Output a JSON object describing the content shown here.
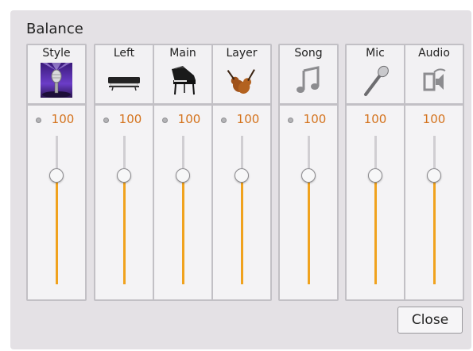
{
  "panel": {
    "title": "Balance"
  },
  "channels": [
    {
      "id": "style",
      "label": "Style",
      "value": "100",
      "level": 0.73,
      "led": true,
      "icon": "microphone-stage-image"
    },
    {
      "id": "left",
      "label": "Left",
      "value": "100",
      "level": 0.73,
      "led": true,
      "icon": "keyboard-icon"
    },
    {
      "id": "main",
      "label": "Main",
      "value": "100",
      "level": 0.73,
      "led": true,
      "icon": "grand-piano-icon"
    },
    {
      "id": "layer",
      "label": "Layer",
      "value": "100",
      "level": 0.73,
      "led": true,
      "icon": "violins-icon"
    },
    {
      "id": "song",
      "label": "Song",
      "value": "100",
      "level": 0.73,
      "led": true,
      "icon": "music-note-icon"
    },
    {
      "id": "mic",
      "label": "Mic",
      "value": "100",
      "level": 0.73,
      "led": false,
      "icon": "microphone-icon"
    },
    {
      "id": "audio",
      "label": "Audio",
      "value": "100",
      "level": 0.73,
      "led": false,
      "icon": "audio-device-icon"
    }
  ],
  "close_button": {
    "label": "Close"
  },
  "colors": {
    "accent": "#f0a21e",
    "value_text": "#d4731d",
    "panel": "#e4e1e5"
  }
}
